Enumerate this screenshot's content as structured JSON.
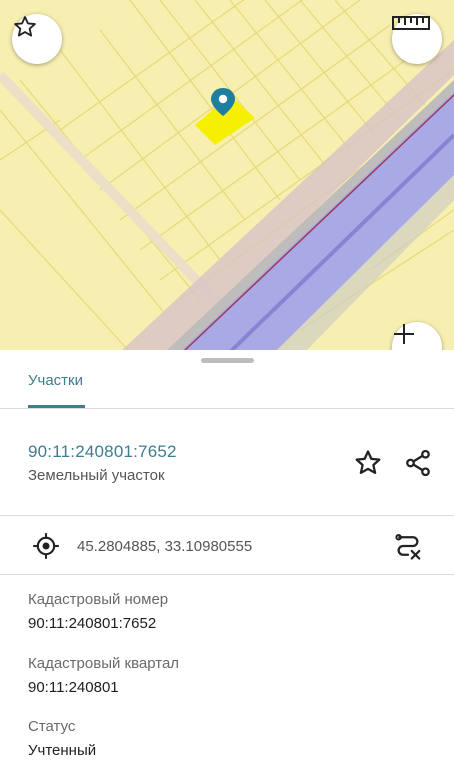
{
  "tabs": {
    "active_label": "Участки"
  },
  "parcel": {
    "cadastral_id": "90:11:240801:7652",
    "type": "Земельный участок",
    "coordinates": "45.2804885, 33.10980555"
  },
  "details": [
    {
      "label": "Кадастровый номер",
      "value": "90:11:240801:7652"
    },
    {
      "label": "Кадастровый квартал",
      "value": "90:11:240801"
    },
    {
      "label": "Статус",
      "value": "Учтенный"
    }
  ],
  "icons": {
    "map_favorite": "star-outline-icon",
    "map_ruler": "ruler-icon",
    "map_compass": "compass-icon",
    "marker": "location-pin-icon",
    "favorite": "star-outline-icon",
    "share": "share-icon",
    "locate": "crosshair-icon",
    "route": "route-icon"
  },
  "colors": {
    "accent": "#3d7d8c",
    "map_background": "#f7efb0",
    "parcel_highlight": "#f5f000",
    "road_band": "#a9a9e6",
    "marker": "#1e7ea0"
  }
}
